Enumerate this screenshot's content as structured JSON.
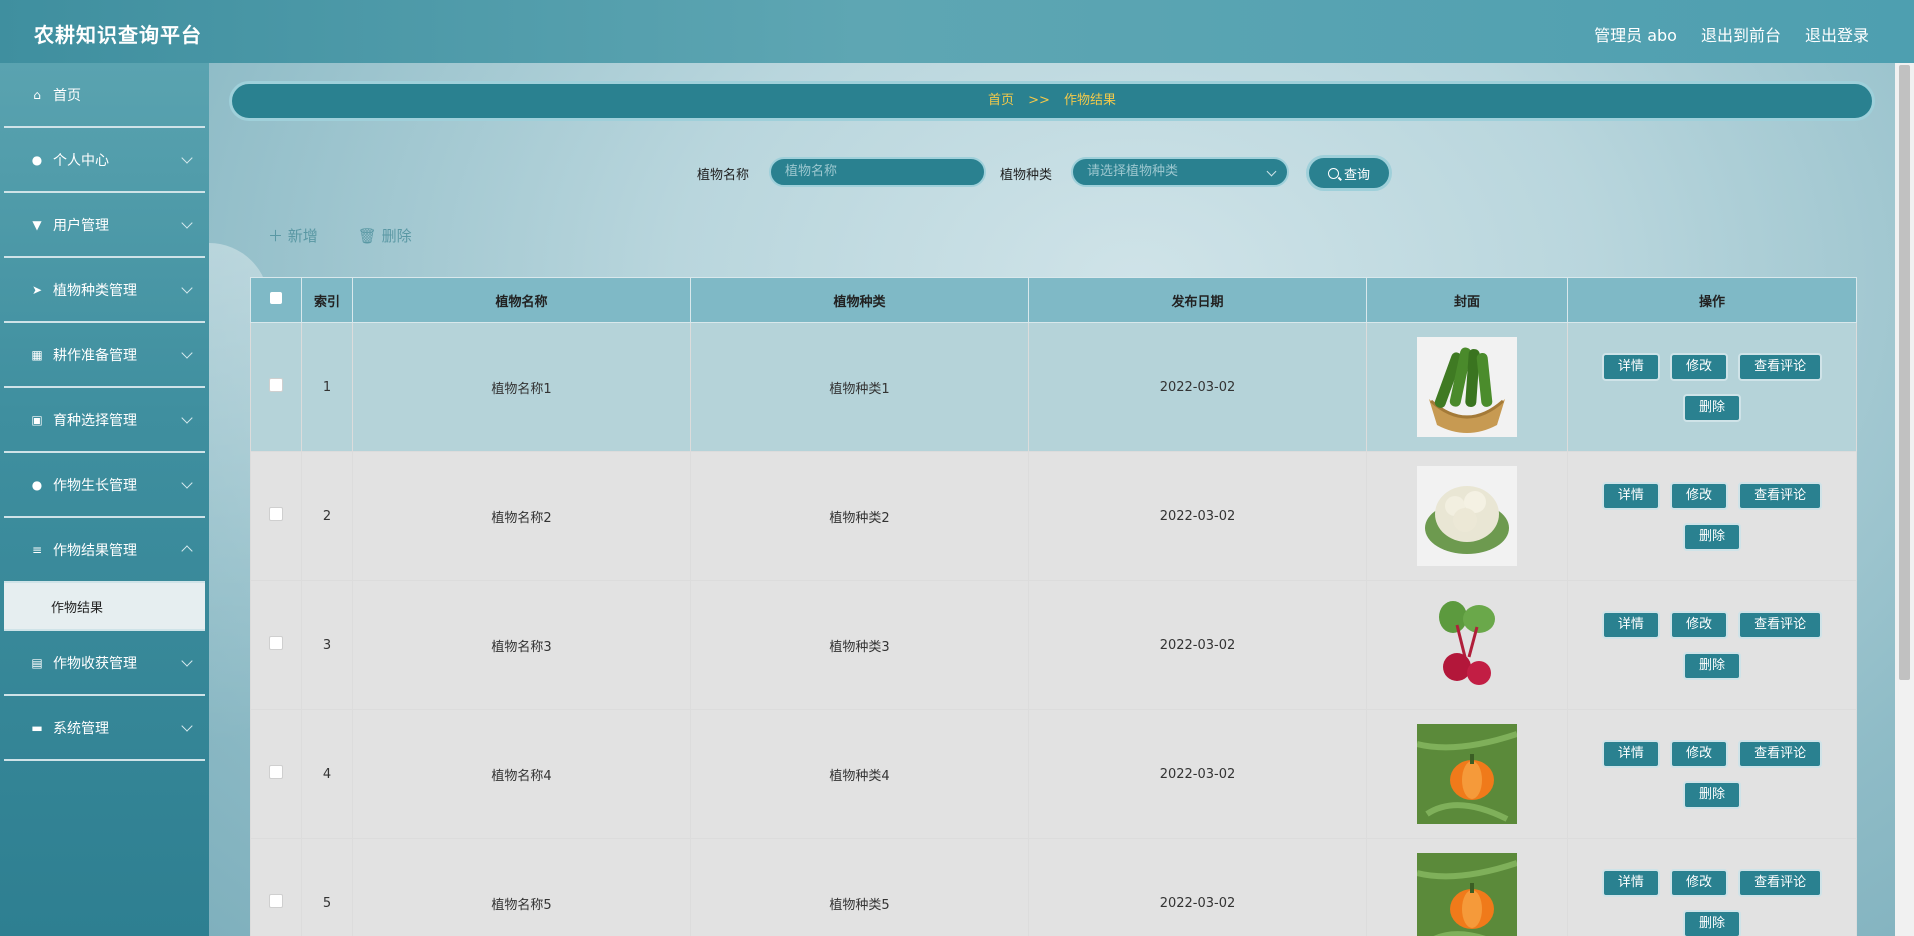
{
  "header": {
    "title": "农耕知识查询平台",
    "admin": "管理员 abo",
    "to_front": "退出到前台",
    "logout": "退出登录"
  },
  "sidebar": {
    "items": [
      {
        "label": "首页",
        "icon": "home-icon"
      },
      {
        "label": "个人中心",
        "icon": "user-icon"
      },
      {
        "label": "用户管理",
        "icon": "stamp-icon"
      },
      {
        "label": "植物种类管理",
        "icon": "send-icon"
      },
      {
        "label": "耕作准备管理",
        "icon": "grid-icon"
      },
      {
        "label": "育种选择管理",
        "icon": "apps-icon"
      },
      {
        "label": "作物生长管理",
        "icon": "user-icon"
      },
      {
        "label": "作物结果管理",
        "icon": "sliders-icon"
      },
      {
        "label": "作物收获管理",
        "icon": "clipboard-icon"
      },
      {
        "label": "系统管理",
        "icon": "briefcase-icon"
      }
    ],
    "active_sub": "作物结果"
  },
  "breadcrumb": {
    "home": "首页",
    "sep": ">>",
    "current": "作物结果"
  },
  "search": {
    "name_label": "植物名称",
    "name_placeholder": "植物名称",
    "type_label": "植物种类",
    "type_placeholder": "请选择植物种类",
    "query_label": "查询"
  },
  "actions": {
    "add": "＋ 新增",
    "delete": "删除"
  },
  "table": {
    "columns": [
      "索引",
      "植物名称",
      "植物种类",
      "发布日期",
      "封面",
      "操作"
    ],
    "rows": [
      {
        "index": "1",
        "name": "植物名称1",
        "type": "植物种类1",
        "date": "2022-03-02",
        "cover": "cucumber"
      },
      {
        "index": "2",
        "name": "植物名称2",
        "type": "植物种类2",
        "date": "2022-03-02",
        "cover": "cauliflower"
      },
      {
        "index": "3",
        "name": "植物名称3",
        "type": "植物种类3",
        "date": "2022-03-02",
        "cover": "beet"
      },
      {
        "index": "4",
        "name": "植物名称4",
        "type": "植物种类4",
        "date": "2022-03-02",
        "cover": "pumpkin"
      },
      {
        "index": "5",
        "name": "植物名称5",
        "type": "植物种类5",
        "date": "2022-03-02",
        "cover": "pumpkin"
      }
    ],
    "buttons": {
      "detail": "详情",
      "edit": "修改",
      "comments": "查看评论",
      "delete": "删除"
    }
  },
  "colors": {
    "accent": "#2a8190",
    "breadcrumb_text": "#f3c94a",
    "header_bg": "#7fb9c6"
  }
}
